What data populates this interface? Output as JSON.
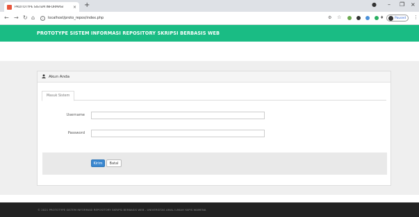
{
  "browser": {
    "tab_title": "PROTOTYPE SISTEM INFORMASI",
    "tab_close": "×",
    "new_tab": "+",
    "url": "localhost/proto_repos/index.php",
    "profile_label": "Paused"
  },
  "site": {
    "title": "PROTOTYPE SISTEM INFORMASI REPOSITORY SKRIPSI BERBASIS WEB"
  },
  "panel": {
    "heading": "Akun Anda",
    "tab_label": "Masuk Sistem",
    "username_label": "Username",
    "username_value": "",
    "password_label": "Password",
    "password_value": "",
    "submit_label": "Kirim",
    "cancel_label": "Batal"
  },
  "footer": {
    "text": "© 2021 PROTOTYPE SISTEM INFORMASI REPOSITORY SKRIPSI BERBASIS WEB - UNIVERSITAS AMAL ILMIAH YAPIS WAMENA"
  },
  "colors": {
    "header": "#1abc84",
    "primary_button": "#3a87d0",
    "footer": "#222222"
  }
}
